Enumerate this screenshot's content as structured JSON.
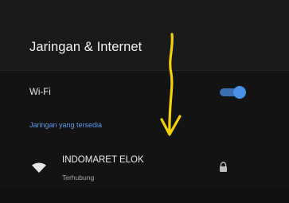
{
  "header": {
    "title": "Jaringan & Internet"
  },
  "wifi": {
    "label": "Wi-Fi",
    "toggle_on": true
  },
  "section": {
    "label": "Jaringan yang tersedia"
  },
  "networks": [
    {
      "name": "INDOMARET ELOK",
      "status": "Terhubung",
      "icon": "wifi-signal-icon",
      "secured": true,
      "lock_icon": "lock-icon"
    }
  ],
  "annotation": {
    "arrow_color": "#f4d10a",
    "icon": "down-arrow-annotation"
  },
  "colors": {
    "accent": "#4a90e6",
    "section_label": "#5c9ae8",
    "background": "#131313"
  }
}
